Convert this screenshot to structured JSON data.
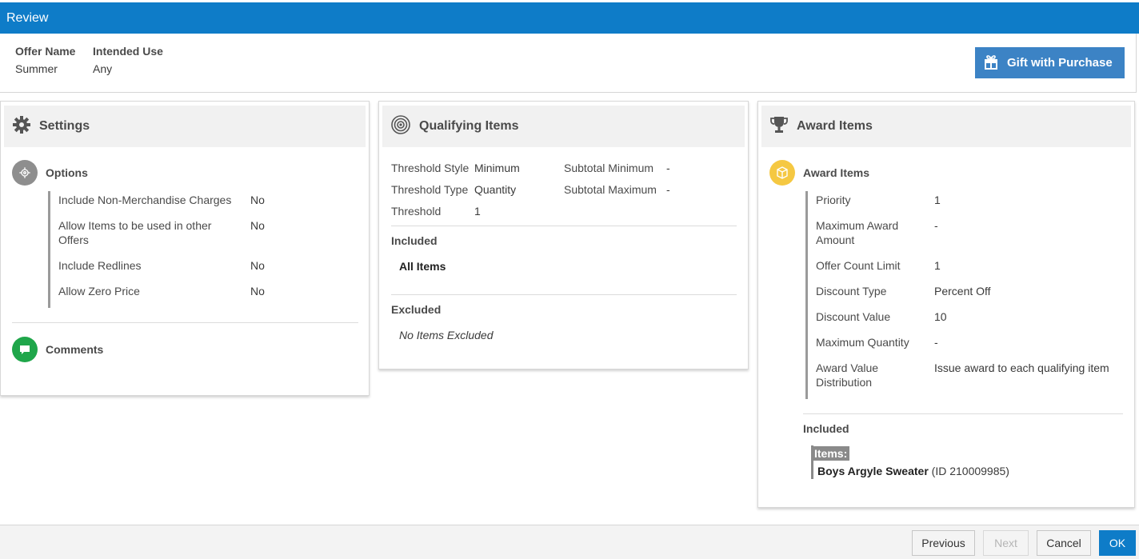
{
  "window": {
    "title": "Review"
  },
  "offer": {
    "name_label": "Offer Name",
    "name_value": "Summer",
    "use_label": "Intended Use",
    "use_value": "Any",
    "type_button": "Gift with Purchase",
    "type_icon": "gift-icon"
  },
  "settings": {
    "title": "Settings",
    "icon": "gear-icon",
    "options_title": "Options",
    "options": [
      {
        "label": "Include Non-Merchandise Charges",
        "value": "No"
      },
      {
        "label": "Allow Items to be used in other Offers",
        "value": "No"
      },
      {
        "label": "Include Redlines",
        "value": "No"
      },
      {
        "label": "Allow Zero Price",
        "value": "No"
      }
    ],
    "comments_title": "Comments"
  },
  "qualifying": {
    "title": "Qualifying Items",
    "icon": "target-icon",
    "threshold_style_label": "Threshold Style",
    "threshold_style_value": "Minimum",
    "threshold_type_label": "Threshold Type",
    "threshold_type_value": "Quantity",
    "threshold_label": "Threshold",
    "threshold_value": "1",
    "subtotal_min_label": "Subtotal Minimum",
    "subtotal_min_value": "-",
    "subtotal_max_label": "Subtotal Maximum",
    "subtotal_max_value": "-",
    "included_label": "Included",
    "included_value": "All Items",
    "excluded_label": "Excluded",
    "excluded_value": "No Items Excluded"
  },
  "award": {
    "title": "Award Items",
    "icon": "trophy-icon",
    "section_title": "Award Items",
    "fields": [
      {
        "label": "Priority",
        "value": "1"
      },
      {
        "label": "Maximum Award Amount",
        "value": "-"
      },
      {
        "label": "Offer Count Limit",
        "value": "1"
      },
      {
        "label": "Discount Type",
        "value": "Percent Off"
      },
      {
        "label": "Discount Value",
        "value": "10"
      },
      {
        "label": "Maximum Quantity",
        "value": "-"
      },
      {
        "label": "Award Value Distribution",
        "value": "Issue award to each qualifying item"
      }
    ],
    "included_label": "Included",
    "items_tag": "Items:",
    "item_name": "Boys Argyle Sweater",
    "item_id": "(ID 210009985)"
  },
  "footer": {
    "previous": "Previous",
    "next": "Next",
    "cancel": "Cancel",
    "ok": "OK"
  },
  "colors": {
    "brand": "#0e7cc8",
    "gift_button": "#3c83c5",
    "comments": "#1fa64a",
    "award_circle": "#f5c842"
  }
}
